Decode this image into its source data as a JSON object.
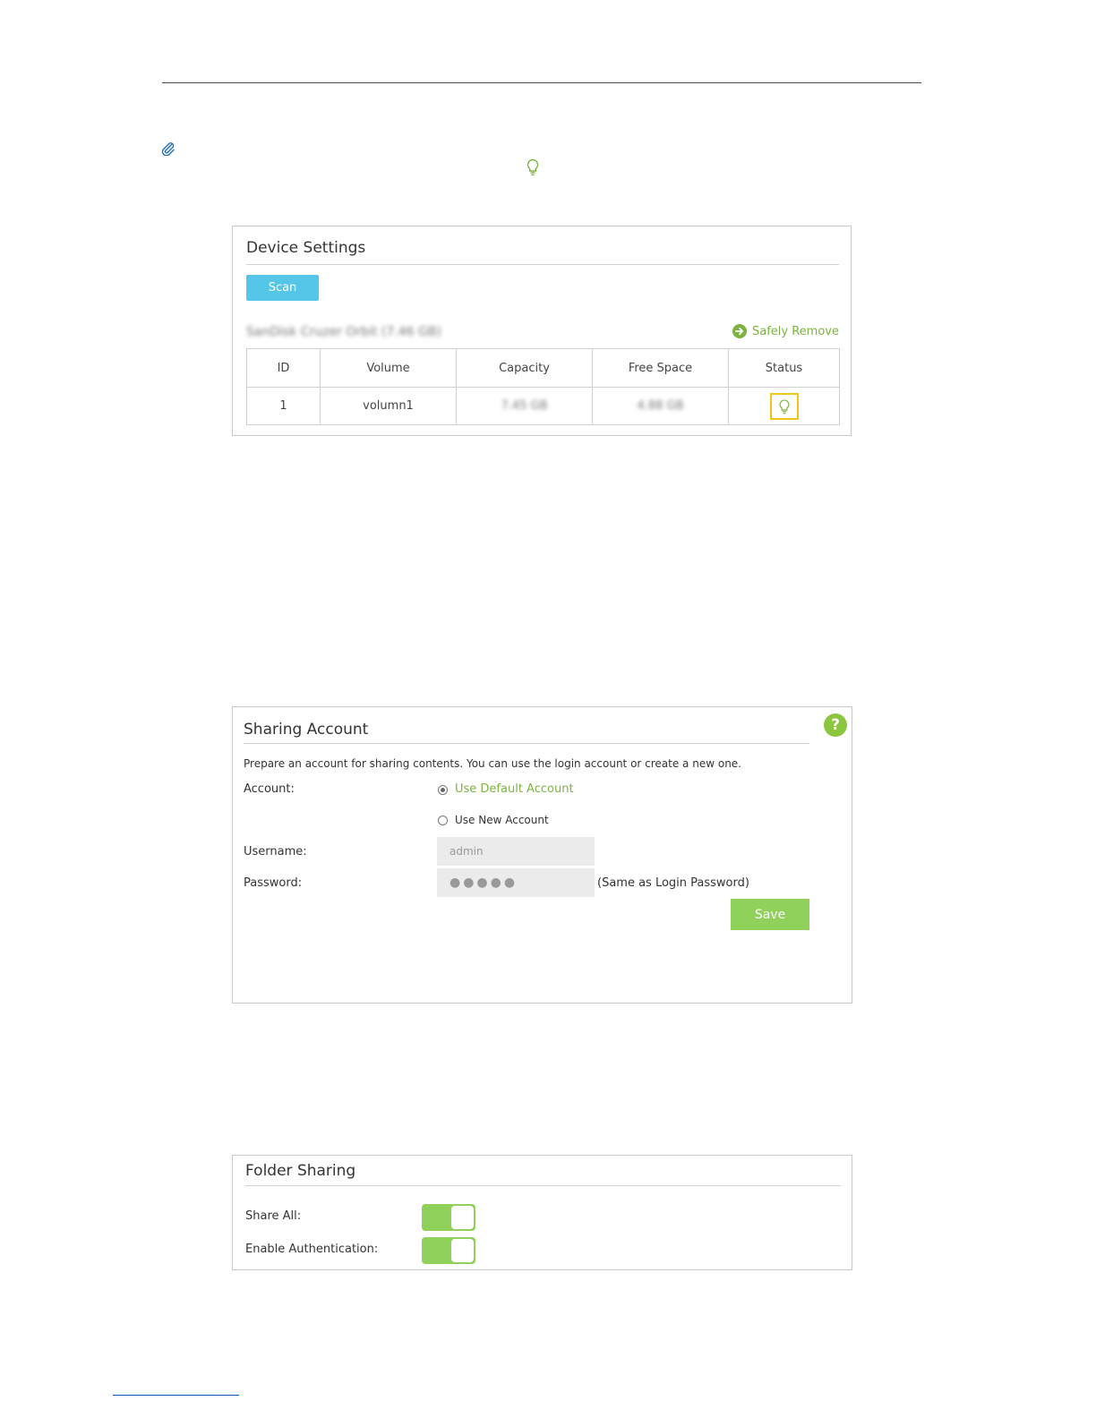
{
  "device_settings": {
    "title": "Device Settings",
    "scan_label": "Scan",
    "device_name": "SanDisk    Cruzer Orbit (7.46 GB)",
    "safely_remove_label": "Safely Remove",
    "columns": [
      "ID",
      "Volume",
      "Capacity",
      "Free Space",
      "Status"
    ],
    "rows": [
      {
        "id": "1",
        "volume": "volumn1",
        "capacity": "7.45 GB",
        "free_space": "4.88 GB",
        "status_icon": "bulb-icon"
      }
    ]
  },
  "sharing_account": {
    "title": "Sharing Account",
    "description": "Prepare an account for sharing contents. You can use the login account or create a new one.",
    "account_label": "Account:",
    "options": [
      "Use Default Account",
      "Use New Account"
    ],
    "selected_option": "Use Default Account",
    "username_label": "Username:",
    "username_value": "admin",
    "password_label": "Password:",
    "password_value": "●●●●●",
    "password_note": "(Same as Login Password)",
    "save_label": "Save",
    "help_icon": "?"
  },
  "folder_sharing": {
    "title": "Folder Sharing",
    "share_all_label": "Share All:",
    "enable_auth_label": "Enable Authentication:"
  },
  "colors": {
    "accent_green": "#8cc63f",
    "scan_blue": "#56c6e8",
    "highlight_yellow": "#f0c419"
  }
}
